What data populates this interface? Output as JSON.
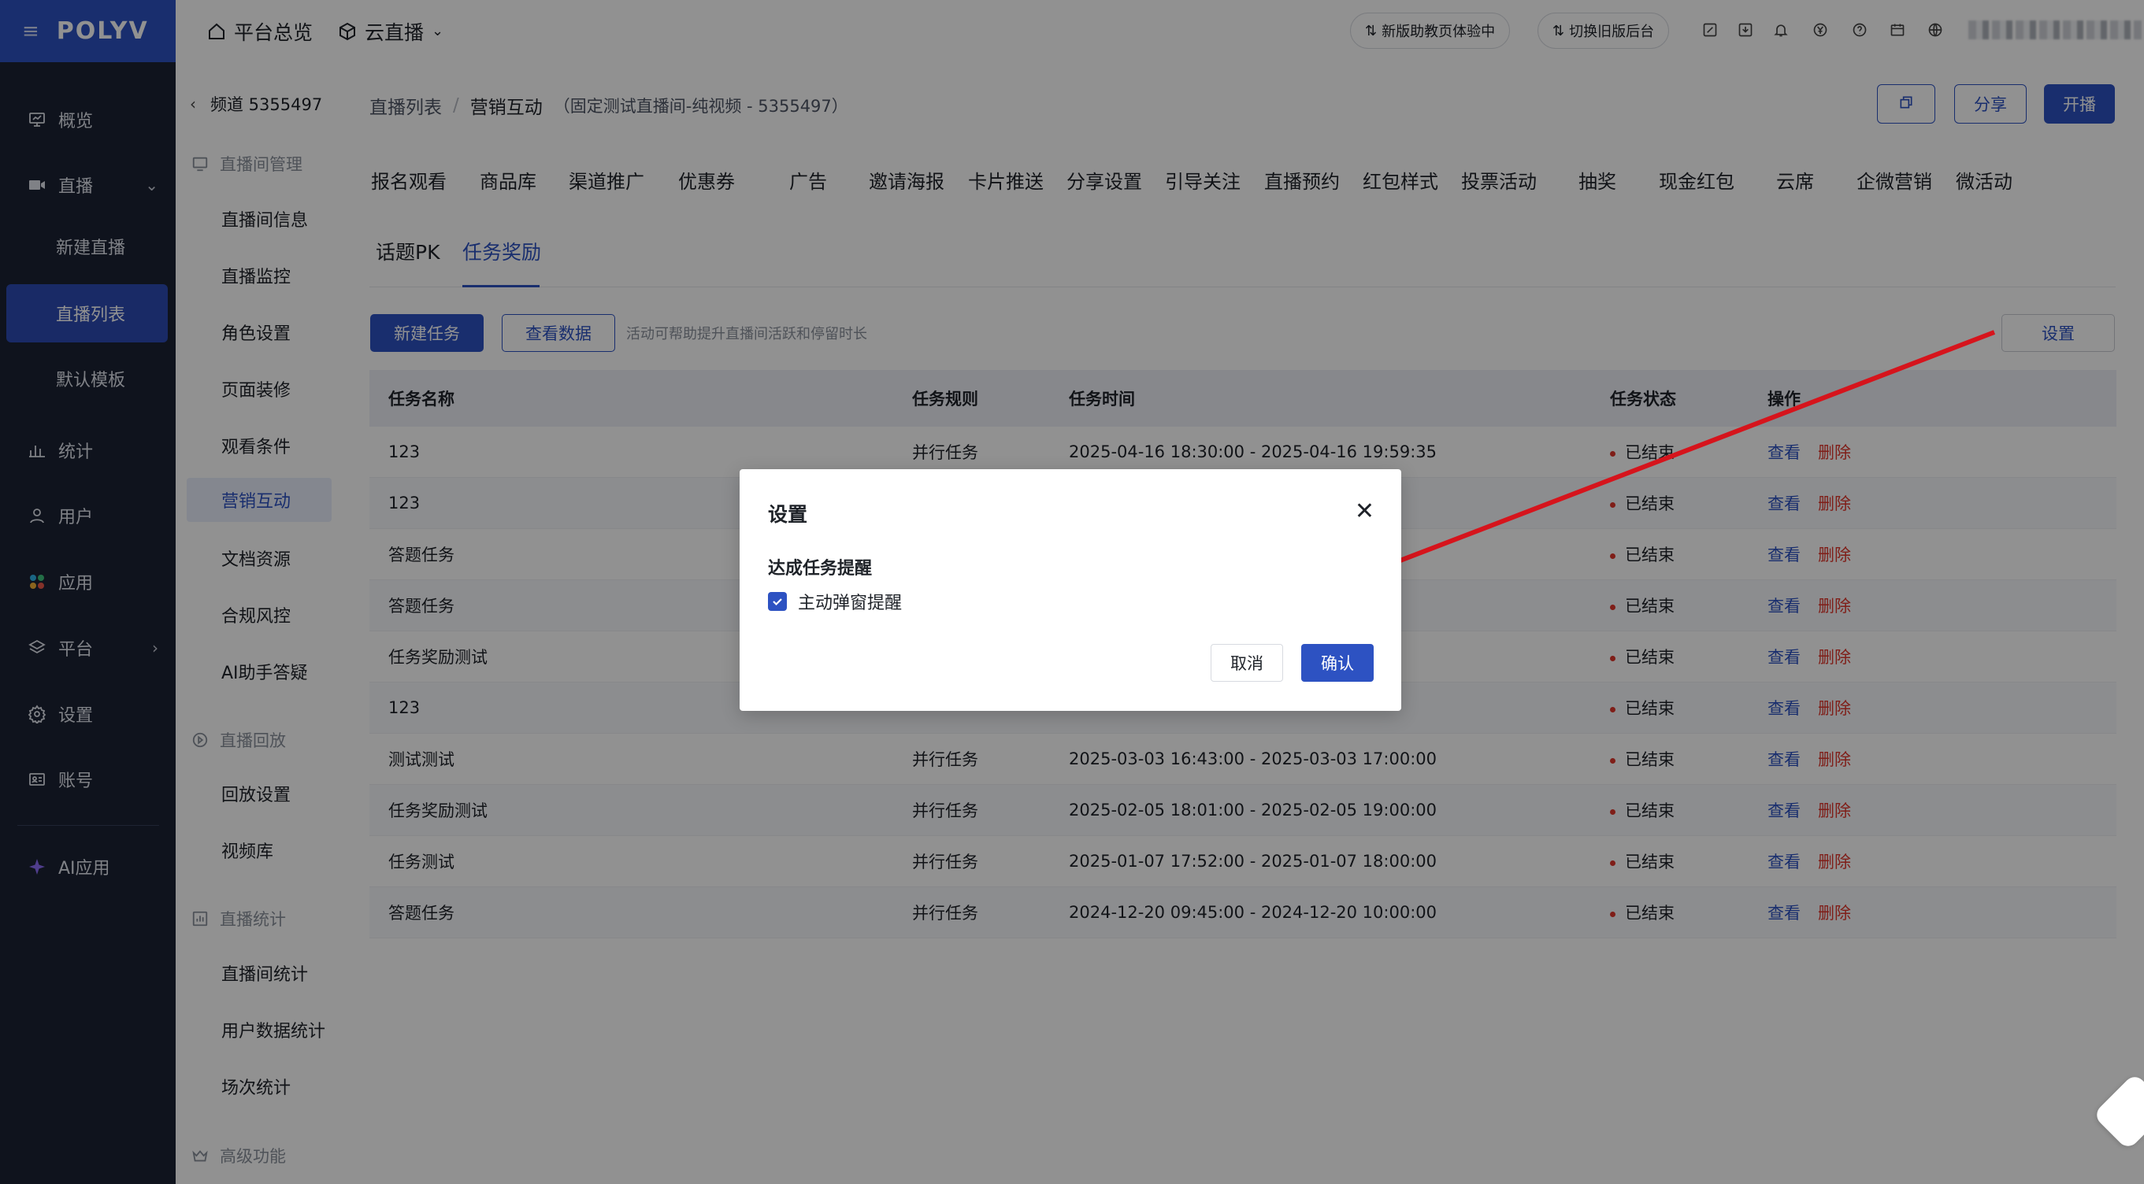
{
  "brand": {
    "logo": "POLYV",
    "accent": "#2d52c2",
    "danger": "#e0352b"
  },
  "left_nav": {
    "items": [
      {
        "label": "概览",
        "icon": "monitor-icon"
      },
      {
        "label": "直播",
        "icon": "live-icon"
      },
      {
        "label": "统计",
        "icon": "bar-chart-icon"
      },
      {
        "label": "用户",
        "icon": "user-icon"
      },
      {
        "label": "应用",
        "icon": "apps-icon"
      },
      {
        "label": "平台",
        "icon": "layers-icon"
      },
      {
        "label": "设置",
        "icon": "gear-icon"
      },
      {
        "label": "账号",
        "icon": "id-card-icon"
      },
      {
        "label": "AI应用",
        "icon": "sparkle-icon"
      }
    ],
    "live_sub": [
      "新建直播",
      "直播列表",
      "默认模板"
    ]
  },
  "topbar": {
    "home": "平台总览",
    "product": "云直播",
    "new_version": "新版助教页体验中",
    "switch_old": "切换旧版后台"
  },
  "subnav": {
    "channel": "频道 5355497",
    "groups": {
      "manage": "直播间管理",
      "replay": "直播回放",
      "stats": "直播统计",
      "advanced": "高级功能"
    },
    "manage_items": [
      "直播间信息",
      "直播监控",
      "角色设置",
      "页面装修",
      "观看条件",
      "营销互动",
      "文档资源",
      "合规风控",
      "AI助手答疑"
    ],
    "replay_items": [
      "回放设置",
      "视频库"
    ],
    "stats_items": [
      "直播间统计",
      "用户数据统计",
      "场次统计"
    ]
  },
  "main": {
    "breadcrumb_root": "直播列表",
    "breadcrumb_sep": "/",
    "breadcrumb_current": "营销互动",
    "breadcrumb_note": "（固定测试直播间-纯视频 - 5355497）",
    "share": "分享",
    "start": "开播",
    "tabs": [
      "报名观看",
      "商品库",
      "渠道推广",
      "优惠券",
      "广告",
      "邀请海报",
      "卡片推送",
      "分享设置",
      "引导关注",
      "直播预约",
      "红包样式",
      "投票活动",
      "抽奖",
      "现金红包",
      "云席",
      "企微营销",
      "微活动"
    ],
    "subtabs": [
      "话题PK",
      "任务奖励"
    ],
    "new_task": "新建任务",
    "view_data": "查看数据",
    "hint": "活动可帮助提升直播间活跃和停留时长",
    "settings": "设置"
  },
  "table": {
    "headers": [
      "任务名称",
      "任务规则",
      "任务时间",
      "任务状态",
      "操作"
    ],
    "view": "查看",
    "delete": "删除",
    "rows": [
      {
        "name": "123",
        "rule": "并行任务",
        "time": "2025-04-16 18:30:00 - 2025-04-16 19:59:35",
        "status": "已结束"
      },
      {
        "name": "123",
        "rule": "",
        "time": "",
        "status": "已结束"
      },
      {
        "name": "答题任务",
        "rule": "",
        "time": "",
        "status": "已结束"
      },
      {
        "name": "答题任务",
        "rule": "",
        "time": "",
        "status": "已结束"
      },
      {
        "name": "任务奖励测试",
        "rule": "",
        "time": "",
        "status": "已结束"
      },
      {
        "name": "123",
        "rule": "",
        "time": "",
        "status": "已结束"
      },
      {
        "name": "测试测试",
        "rule": "并行任务",
        "time": "2025-03-03 16:43:00 - 2025-03-03 17:00:00",
        "status": "已结束"
      },
      {
        "name": "任务奖励测试",
        "rule": "并行任务",
        "time": "2025-02-05 18:01:00 - 2025-02-05 19:00:00",
        "status": "已结束"
      },
      {
        "name": "任务测试",
        "rule": "并行任务",
        "time": "2025-01-07 17:52:00 - 2025-01-07 18:00:00",
        "status": "已结束"
      },
      {
        "name": "答题任务",
        "rule": "并行任务",
        "time": "2024-12-20 09:45:00 - 2024-12-20 10:00:00",
        "status": "已结束"
      }
    ]
  },
  "dialog": {
    "title": "设置",
    "section": "达成任务提醒",
    "checkbox_label": "主动弹窗提醒",
    "checked": true,
    "cancel": "取消",
    "confirm": "确认"
  }
}
